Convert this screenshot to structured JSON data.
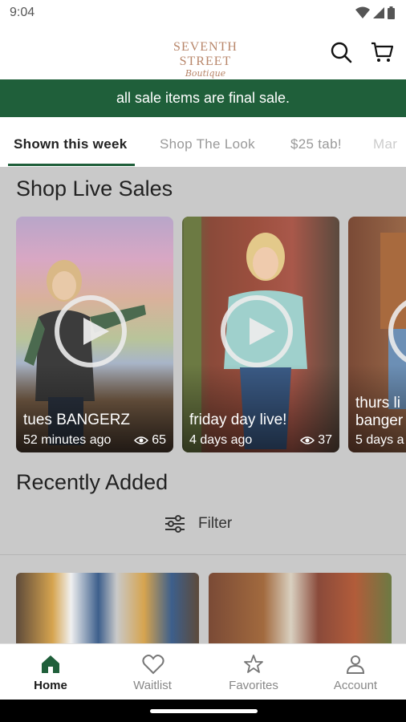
{
  "status_bar": {
    "time": "9:04"
  },
  "header": {
    "logo_line1": "SEVENTH STREET",
    "logo_line2": "Boutique",
    "search_icon": "search-icon",
    "cart_icon": "cart-icon"
  },
  "banner": {
    "text": "all sale items are final sale.",
    "color": "#1f5f3a"
  },
  "tabs": [
    {
      "label": "Shown this week",
      "active": true
    },
    {
      "label": "Shop The Look"
    },
    {
      "label": "$25 tab!"
    },
    {
      "label": "Mar"
    }
  ],
  "live_sales": {
    "title": "Shop Live Sales",
    "cards": [
      {
        "title": "tues BANGERZ",
        "time": "52 minutes ago",
        "views": "65"
      },
      {
        "title": "friday day live!",
        "time": "4 days ago",
        "views": "37"
      },
      {
        "title": "thurs li",
        "title2": "banger",
        "time": "5 days a"
      }
    ]
  },
  "recently_added": {
    "title": "Recently Added",
    "filter_label": "Filter"
  },
  "bottom_nav": [
    {
      "label": "Home",
      "icon": "home-icon",
      "active": true
    },
    {
      "label": "Waitlist",
      "icon": "heart-icon"
    },
    {
      "label": "Favorites",
      "icon": "star-icon"
    },
    {
      "label": "Account",
      "icon": "person-icon"
    }
  ]
}
